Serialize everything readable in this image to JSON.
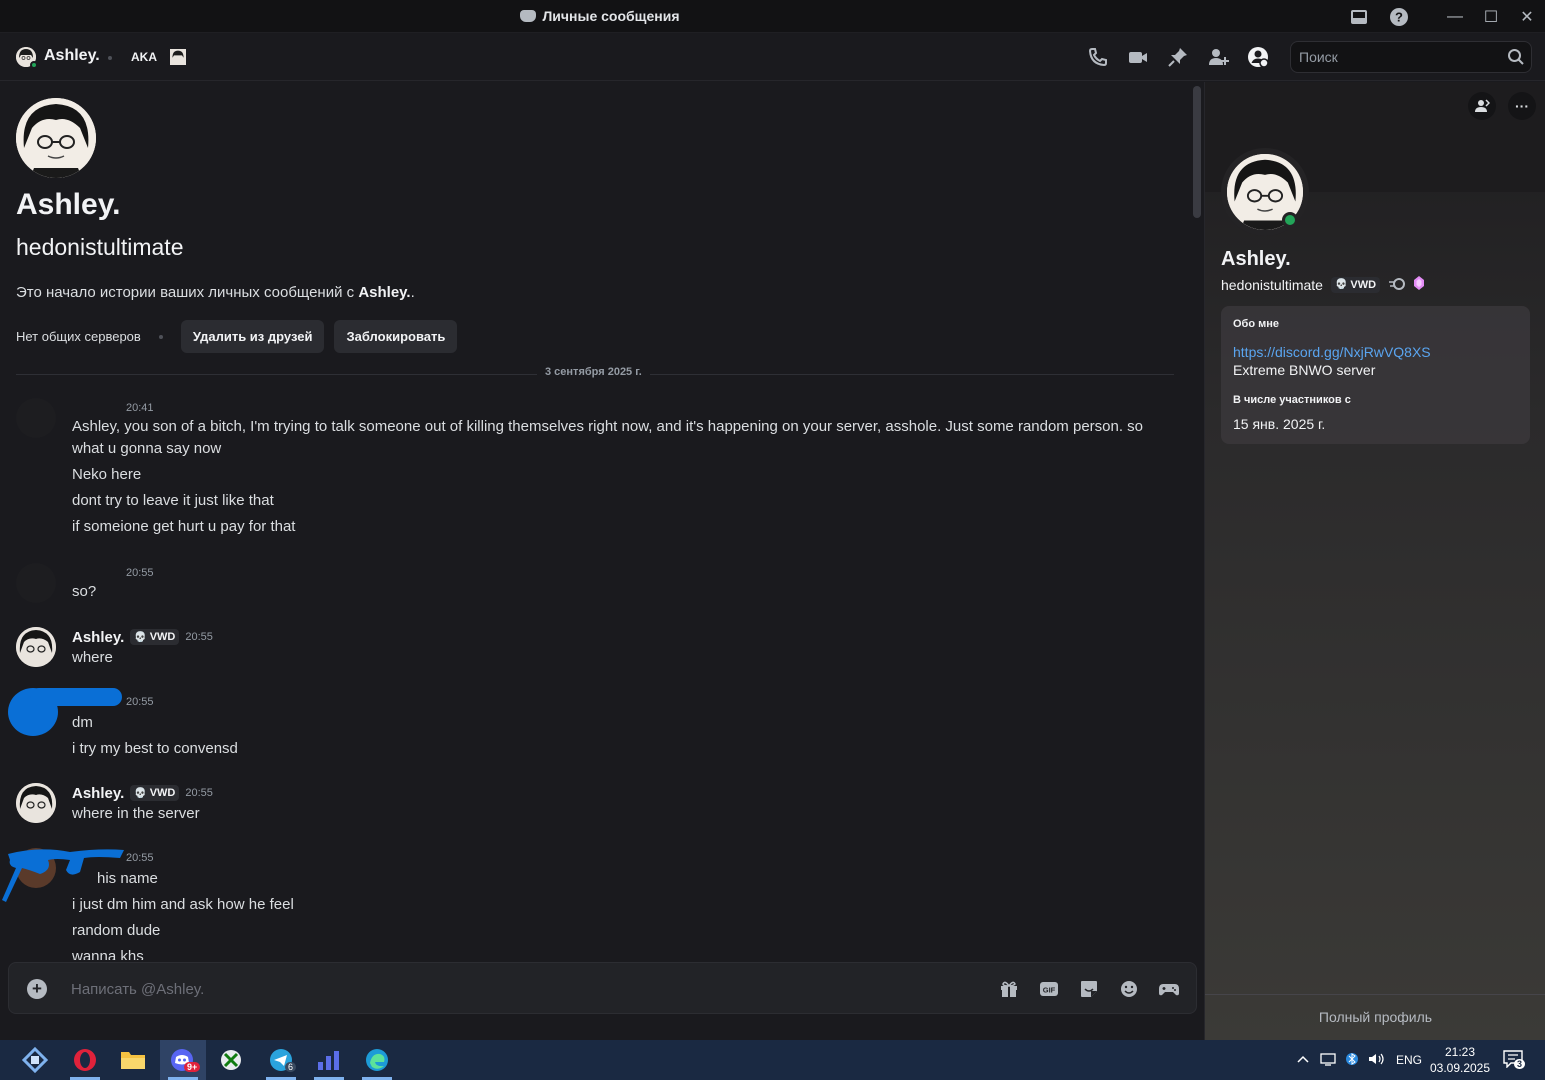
{
  "window": {
    "title": "Личные сообщения"
  },
  "header": {
    "name": "Ashley.",
    "aka": "AKA",
    "search_placeholder": "Поиск"
  },
  "intro": {
    "display_name": "Ashley.",
    "username": "hedonistultimate",
    "text_prefix": "Это начало истории ваших личных сообщений с ",
    "text_name": "Ashley.",
    "text_suffix": ".",
    "mutual": "Нет общих серверов",
    "remove_friend": "Удалить из друзей",
    "block": "Заблокировать"
  },
  "date_divider": "3 сентября 2025 г.",
  "messages": [
    {
      "author": "",
      "time": "20:41",
      "lines": [
        "Ashley, you son of a bitch, I'm trying to talk someone out of killing themselves right now, and it's happening on your server, asshole. Just some random person. so",
        "what u gonna say now",
        "Neko here",
        "dont try to leave it just like that",
        "if someione get hurt u pay for that"
      ]
    },
    {
      "author": "",
      "time": "20:55",
      "lines": [
        "so?"
      ]
    },
    {
      "author": "Ashley.",
      "tag": "VWD",
      "time": "20:55",
      "lines": [
        "where"
      ]
    },
    {
      "author": "",
      "time": "20:55",
      "lines": [
        "dm",
        "i try my best to convensd"
      ]
    },
    {
      "author": "Ashley.",
      "tag": "VWD",
      "time": "20:55",
      "lines": [
        "where in the server"
      ]
    },
    {
      "author": "",
      "time": "20:55",
      "lines": [
        "his name",
        "i just dm him and ask how he feel",
        "random dude",
        "wanna khs"
      ]
    }
  ],
  "composer": {
    "placeholder": "Написать @Ashley."
  },
  "profile": {
    "name": "Ashley.",
    "username": "hedonistultimate",
    "tag": "VWD",
    "about_title": "Обо мне",
    "about_link": "https://discord.gg/NxjRwVQ8XS",
    "about_desc": "Extreme BNWO server",
    "member_since_title": "В числе участников с",
    "member_since": "15 янв. 2025 г.",
    "full_profile": "Полный профиль"
  },
  "taskbar": {
    "lang": "ENG",
    "time": "21:23",
    "date": "03.09.2025",
    "discord_badge": "9+",
    "telegram_badge": "6",
    "notif_count": "3"
  },
  "colors": {
    "accent": "#5aa5f0",
    "online": "#23a559",
    "scribble": "#0a6fd6"
  }
}
